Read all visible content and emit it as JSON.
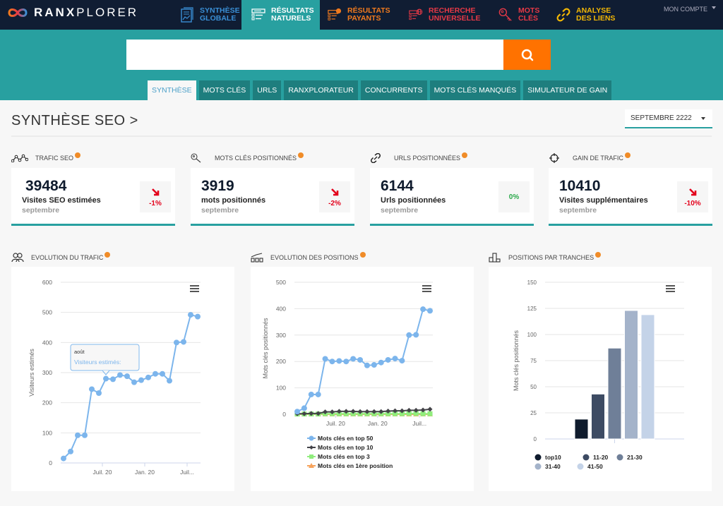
{
  "brand": {
    "name_bold": "RANX",
    "name_light": "PLORER"
  },
  "nav": [
    {
      "line1": "SYNTHÈSE",
      "line2": "GLOBALE",
      "color": "#3a8fd6",
      "icon": "report-icon",
      "active": false
    },
    {
      "line1": "RÉSULTATS",
      "line2": "NATURELS",
      "color": "#ffffff",
      "icon": "list-icon",
      "active": true
    },
    {
      "line1": "RÉSULTATS",
      "line2": "PAYANTS",
      "color": "#f07a1e",
      "icon": "paid-list-icon",
      "active": false
    },
    {
      "line1": "RECHERCHE",
      "line2": "UNIVERSELLE",
      "color": "#e63946",
      "icon": "globe-list-icon",
      "active": false
    },
    {
      "line1": "MOTS",
      "line2": "CLÉS",
      "color": "#e63946",
      "icon": "key-icon",
      "active": false
    },
    {
      "line1": "ANALYSE",
      "line2": "DES LIENS",
      "color": "#f2b705",
      "icon": "link-icon",
      "active": false
    }
  ],
  "account": {
    "label": "MON COMPTE"
  },
  "search": {
    "value": "",
    "placeholder": ""
  },
  "subtabs": [
    "SYNTHÈSE",
    "MOTS CLÉS",
    "URLS",
    "RANXPLORATEUR",
    "CONCURRENTS",
    "MOTS CLÉS MANQUÉS",
    "SIMULATEUR DE GAIN"
  ],
  "page": {
    "title": "SYNTHÈSE SEO >",
    "period": "SEPTEMBRE 2222"
  },
  "kpis": [
    {
      "title": "TRAFIC SEO",
      "icon": "trend-nodes-icon",
      "value": "39484",
      "label": "Visites SEO estimées",
      "month": "septembre",
      "delta": "-1%",
      "trend": "down"
    },
    {
      "title": "MOTS CLÉS POSITIONNÉS",
      "icon": "key-search-icon",
      "value": "3919",
      "label": "mots positionnés",
      "month": "septembre",
      "delta": "-2%",
      "trend": "down"
    },
    {
      "title": "URLS POSITIONNÉES",
      "icon": "link-icon",
      "value": "6144",
      "label": "Urls positionnées",
      "month": "septembre",
      "delta": "0%",
      "trend": "flat"
    },
    {
      "title": "GAIN DE TRAFIC",
      "icon": "target-icon",
      "value": "10410",
      "label": "Visites supplémentaires",
      "month": "septembre",
      "delta": "-10%",
      "trend": "down"
    }
  ],
  "sections": {
    "traffic": "EVOLUTION DU TRAFIC",
    "positions": "EVOLUTION DES POSITIONS",
    "tranches": "POSITIONS PAR TRANCHES"
  },
  "tooltip": {
    "title": "août",
    "label": "Visiteurs estimés:"
  },
  "chart_data": [
    {
      "type": "line",
      "title": "EVOLUTION DU TRAFIC",
      "ylabel": "Visiteurs estimés",
      "xlabel": "",
      "ylim": [
        0,
        600
      ],
      "yticks": [
        0,
        100,
        200,
        300,
        400,
        500,
        600
      ],
      "xtick_labels": [
        {
          "index": 5,
          "label": "Juil. 20"
        },
        {
          "index": 11,
          "label": "Jan. 20"
        },
        {
          "index": 17,
          "label": "Juil..."
        }
      ],
      "grid": true,
      "series": [
        {
          "name": "Visiteurs estimés",
          "color": "#7cb5ec",
          "values": [
            15,
            38,
            92,
            92,
            245,
            232,
            280,
            278,
            292,
            288,
            268,
            275,
            284,
            296,
            296,
            273,
            400,
            402,
            492,
            486
          ]
        }
      ]
    },
    {
      "type": "line",
      "title": "EVOLUTION DES POSITIONS",
      "ylabel": "Mots clés positionnés",
      "xlabel": "",
      "ylim": [
        0,
        500
      ],
      "yticks": [
        0,
        100,
        200,
        300,
        400,
        500
      ],
      "xtick_labels": [
        {
          "index": 5,
          "label": "Juil. 20"
        },
        {
          "index": 11,
          "label": "Jan. 20"
        },
        {
          "index": 17,
          "label": "Juil..."
        }
      ],
      "grid": true,
      "legend": "bottom",
      "series": [
        {
          "name": "Mots clés en top 50",
          "color": "#7cb5ec",
          "marker": "circle",
          "values": [
            10,
            23,
            75,
            75,
            210,
            200,
            202,
            200,
            210,
            206,
            185,
            187,
            196,
            206,
            211,
            203,
            300,
            301,
            398,
            392
          ]
        },
        {
          "name": "Mots clés en top 10",
          "color": "#434348",
          "marker": "diamond",
          "values": [
            2,
            2,
            3,
            3,
            9,
            9,
            11,
            11,
            11,
            10,
            10,
            10,
            10,
            12,
            13,
            13,
            15,
            15,
            16,
            19
          ]
        },
        {
          "name": "Mots clés en top 3",
          "color": "#90ed7d",
          "marker": "square",
          "values": [
            1,
            1,
            1,
            1,
            2,
            2,
            2,
            2,
            2,
            2,
            2,
            2,
            2,
            2,
            2,
            2,
            3,
            3,
            2,
            2
          ]
        },
        {
          "name": "Mots clés en 1ère position",
          "color": "#f7a35c",
          "marker": "triangle",
          "values": [
            0,
            0,
            0,
            0,
            0,
            0,
            0,
            0,
            0,
            0,
            0,
            0,
            0,
            0,
            0,
            0,
            0,
            0,
            0,
            0
          ]
        }
      ]
    },
    {
      "type": "bar",
      "title": "POSITIONS PAR TRANCHES",
      "ylabel": "Mots clés positionnés",
      "xlabel": "",
      "ylim": [
        0,
        150
      ],
      "yticks": [
        0,
        25,
        50,
        75,
        100,
        125,
        150
      ],
      "grid": true,
      "legend": "bottom",
      "categories": [
        "top10",
        "11-20",
        "21-30",
        "31-40",
        "41-50"
      ],
      "values": [
        19,
        43,
        87,
        123,
        119
      ],
      "colors": [
        "#0f1b2d",
        "#3d4b63",
        "#6f7f98",
        "#a4b3ca",
        "#c4d3e8"
      ]
    }
  ]
}
